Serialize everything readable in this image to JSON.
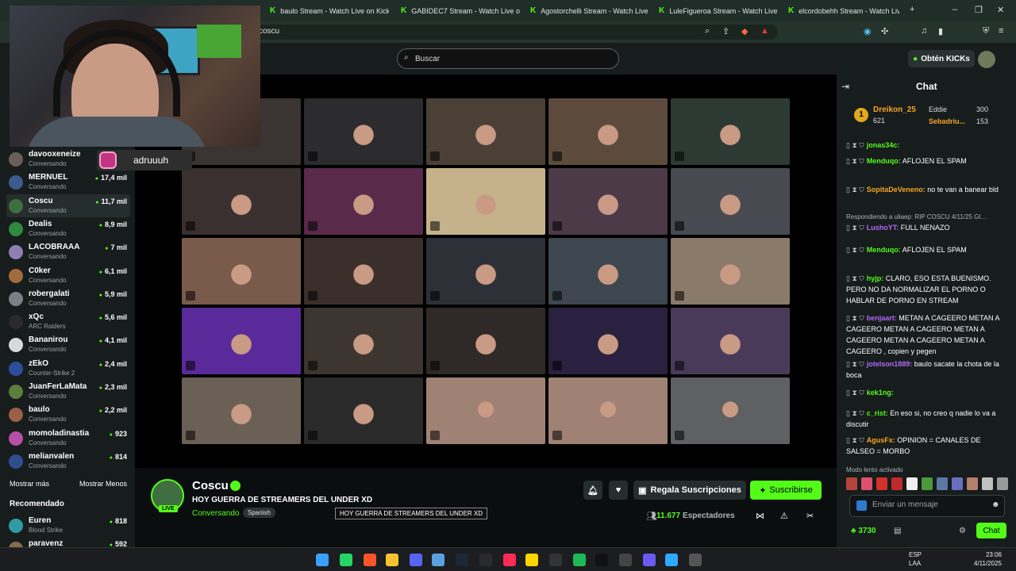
{
  "browser": {
    "tabs": [
      {
        "label": "baulo Stream - Watch Live on Kick"
      },
      {
        "label": "GABIDEC7 Stream - Watch Live on K"
      },
      {
        "label": "Agostorchelli Stream - Watch Live o"
      },
      {
        "label": "LuleFigueroa Stream - Watch Live o"
      },
      {
        "label": "elcordobehh Stream - Watch Live on"
      }
    ],
    "address": "coscu"
  },
  "topbar": {
    "search_placeholder": "Buscar",
    "kicks_label": "Obtén KICKs"
  },
  "overlay": {
    "instagram_handle": "adruuuh"
  },
  "sidebar": {
    "channels": [
      {
        "name": "davooxeneize",
        "category": "Conversando",
        "viewers": "",
        "color": "#6a5f58"
      },
      {
        "name": "MERNUEL",
        "category": "Conversando",
        "viewers": "17,4 mil",
        "color": "#3d5b8c"
      },
      {
        "name": "Coscu",
        "category": "Conversando",
        "viewers": "11,7 mil",
        "color": "#3f6e40"
      },
      {
        "name": "Dealis",
        "category": "Conversando",
        "viewers": "8,9 mil",
        "color": "#2e8a3c"
      },
      {
        "name": "LACOBRAAA",
        "category": "Conversando",
        "viewers": "7 mil",
        "color": "#8c80b5"
      },
      {
        "name": "C0ker",
        "category": "Conversando",
        "viewers": "6,1 mil",
        "color": "#a06b3c"
      },
      {
        "name": "robergalati",
        "category": "Conversando",
        "viewers": "5,9 mil",
        "color": "#7a7f84"
      },
      {
        "name": "xQc",
        "category": "ARC Raiders",
        "viewers": "5,6 mil",
        "color": "#2a2a2a"
      },
      {
        "name": "Bananirou",
        "category": "Conversando",
        "viewers": "4,1 mil",
        "color": "#d9d9d9"
      },
      {
        "name": "zEkO",
        "category": "Counter-Strike 2",
        "viewers": "2,4 mil",
        "color": "#2b4e9a"
      },
      {
        "name": "JuanFerLaMata",
        "category": "Conversando",
        "viewers": "2,3 mil",
        "color": "#5d7d3a"
      },
      {
        "name": "baulo",
        "category": "Conversando",
        "viewers": "2,2 mil",
        "color": "#9a6048"
      },
      {
        "name": "momoladinastia",
        "category": "Conversando",
        "viewers": "923",
        "color": "#b44fa5"
      },
      {
        "name": "melianvalen",
        "category": "Conversando",
        "viewers": "814",
        "color": "#2f4e8c"
      }
    ],
    "show_more": "Mostrar más",
    "show_less": "Mostrar Menos",
    "recommended_title": "Recomendado",
    "recommended": [
      {
        "name": "Euren",
        "category": "Blood Strike",
        "viewers": "818",
        "color": "#2f9aa5"
      },
      {
        "name": "paravenz",
        "category": "",
        "viewers": "592",
        "color": "#8a6a4a"
      }
    ]
  },
  "stream": {
    "streamer": "Coscu",
    "title": "HOY GUERRA DE STREAMERS DEL UNDER XD",
    "category": "Conversando",
    "language": "Spanish",
    "live_badge": "LIVE",
    "tooltip": "HOY GUERRA DE STREAMERS DEL UNDER XD",
    "gift_label": "Regala Suscripciones",
    "subscribe_label": "Suscribirse",
    "viewer_count": "11.677",
    "viewer_label": "Espectadores"
  },
  "chat": {
    "title": "Chat",
    "leaderboard": [
      {
        "name": "Dreikon_25",
        "score": "621"
      },
      {
        "name": "Eddie",
        "score": "300"
      },
      {
        "name": "Sebadriu...",
        "score": "153"
      }
    ],
    "messages": [
      {
        "user": "jonas34c:",
        "text": "",
        "color": "#53fc18"
      },
      {
        "user": "Menduqo:",
        "text": "AFLOJEN EL SPAM",
        "color": "#53fc18"
      },
      {
        "user": "SopitaDeVeneno:",
        "text": "no te van a banear bld",
        "color": "#f5a623"
      },
      {
        "user": "",
        "text": "Respondiendo a uliaep: RIP COSCU 4/11/25 GI...",
        "color": "#aeb6b8"
      },
      {
        "user": "LushoYT:",
        "text": "FULL NENAZO",
        "color": "#b06af7"
      },
      {
        "user": "Menduqo:",
        "text": "AFLOJEN EL SPAM",
        "color": "#53fc18"
      },
      {
        "user": "hyjp:",
        "text": "CLARO, ESO ESTA BUENISMO. PERO NO DA NORMALIZAR EL PORNO O HABLAR DE PORNO EN STREAM",
        "color": "#53fc18"
      },
      {
        "user": "benjaart:",
        "text": "METAN A CAGEERO METAN A CAGEERO METAN A CAGEERO METAN A CAGEERO METAN A CAGEERO METAN A CAGEERO , copien y pegen",
        "color": "#b06af7"
      },
      {
        "user": "jotelson1889:",
        "text": "baulo sacate la chota de la boca",
        "color": "#b06af7"
      },
      {
        "user": "kek1ng:",
        "text": "",
        "color": "#53fc18"
      },
      {
        "user": "c_rist:",
        "text": "En eso si, no creo q nadie lo va a discutir",
        "color": "#53fc18"
      },
      {
        "user": "AgusFx:",
        "text": "OPINION = CANALES DE SALSEO = MORBO",
        "color": "#f5a623"
      }
    ],
    "slow_mode": "Modo lento activado",
    "input_placeholder": "Enviar un mensaje",
    "points": "3730",
    "send_label": "Chat"
  },
  "taskbar": {
    "lang": "ESP",
    "lang_sub": "LAA",
    "time": "23:06",
    "date": "4/11/2025"
  }
}
